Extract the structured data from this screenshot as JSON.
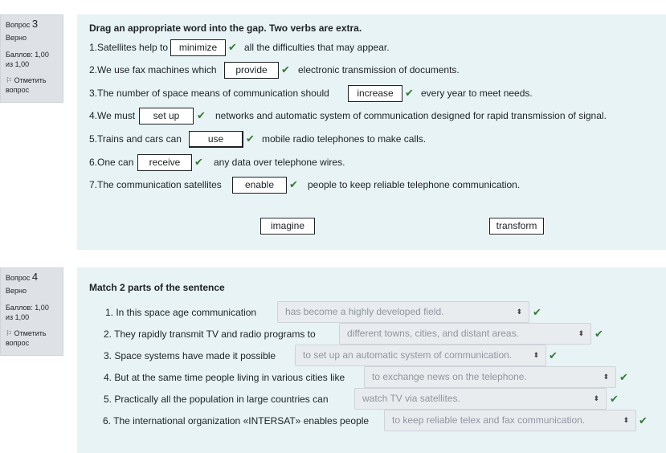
{
  "q3": {
    "label": "Вопрос",
    "number": "3",
    "state": "Верно",
    "grade": "Баллов: 1,00 из 1,00",
    "flag": "Отметить вопрос",
    "prompt": "Drag an appropriate word into the gap. Two verbs are extra.",
    "sentences": [
      {
        "before": "1.Satellites help to",
        "answer": "minimize",
        "after": "all the difficulties that may appear."
      },
      {
        "before": "2.We use fax machines which",
        "answer": "provide",
        "after": "electronic transmission of documents."
      },
      {
        "before": "3.The number of space means of communication should",
        "answer": "increase",
        "after": "every year to meet needs."
      },
      {
        "before": "4.We must",
        "answer": "set up",
        "after": "networks and automatic system of communication designed for rapid transmission of signal."
      },
      {
        "before": "5.Trains and cars can",
        "answer": "use",
        "after": "mobile radio telephones to make calls."
      },
      {
        "before": "6.One can",
        "answer": "receive",
        "after": "any data over telephone wires."
      },
      {
        "before": "7.The communication satellites",
        "answer": "enable",
        "after": "people to keep reliable telephone communication."
      }
    ],
    "extra_words": [
      "imagine",
      "transform"
    ]
  },
  "q4": {
    "label": "Вопрос",
    "number": "4",
    "state": "Верно",
    "grade": "Баллов: 1,00 из 1,00",
    "flag": "Отметить вопрос",
    "prompt": "Match 2 parts of the sentence",
    "rows": [
      {
        "stem": "1. In this space age communication",
        "selected": "has become a highly developed field."
      },
      {
        "stem": "2.  They rapidly transmit TV and radio programs to",
        "selected": "different towns, cities, and distant areas."
      },
      {
        "stem": "3.  Space systems have made it possible",
        "selected": "to set up an automatic system of communication."
      },
      {
        "stem": "4.  But at the same time people living in various cities like",
        "selected": "to exchange news on the telephone."
      },
      {
        "stem": "5.  Practically all the population in large countries can",
        "selected": "watch TV via satellites."
      },
      {
        "stem": "6.   The international organization «INTERSAT» enables people",
        "selected": "to keep reliable telex and fax communication."
      }
    ]
  },
  "icons": {
    "tick": "check-icon",
    "flag": "flag-icon",
    "select_arrow": "updown-arrow-icon"
  },
  "colors": {
    "correct": "#357a32",
    "content_bg": "#e7f3f5",
    "info_bg": "#dee2e6"
  }
}
